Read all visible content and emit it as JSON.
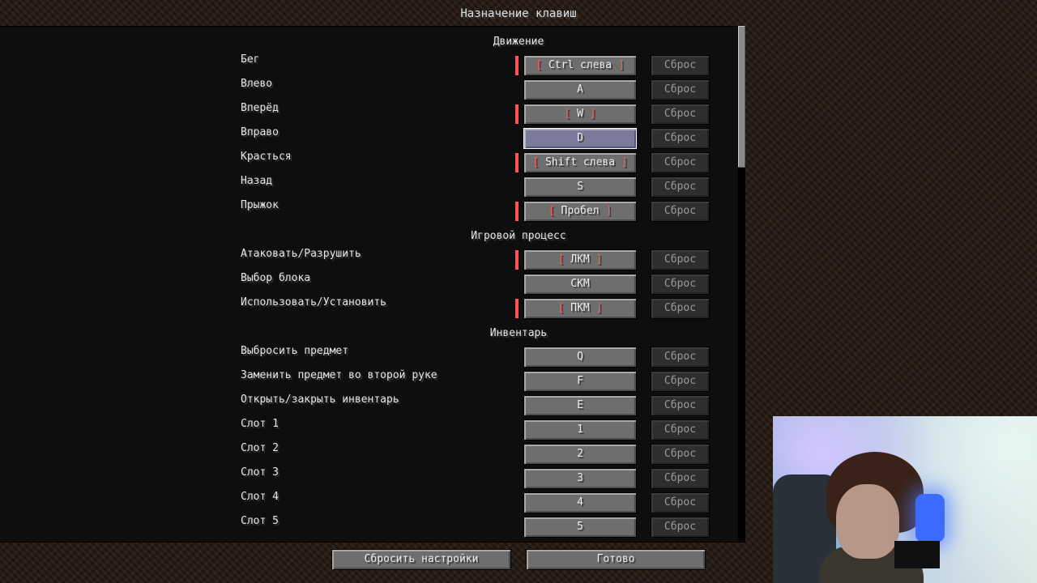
{
  "title": "Назначение клавиш",
  "categories": {
    "movement": "Движение",
    "gameplay": "Игровой процесс",
    "inventory": "Инвентарь"
  },
  "bindings": [
    {
      "action": "Бег",
      "key": "Ctrl слева",
      "conflict": true,
      "reset": "Сброс"
    },
    {
      "action": "Влево",
      "key": "A",
      "conflict": false,
      "reset": "Сброс"
    },
    {
      "action": "Вперёд",
      "key": "W",
      "conflict": true,
      "reset": "Сброс"
    },
    {
      "action": "Вправо",
      "key": "D",
      "conflict": false,
      "reset": "Сброс",
      "hover": true
    },
    {
      "action": "Красться",
      "key": "Shift слева",
      "conflict": true,
      "reset": "Сброс"
    },
    {
      "action": "Назад",
      "key": "S",
      "conflict": false,
      "reset": "Сброс"
    },
    {
      "action": "Прыжок",
      "key": "Пробел",
      "conflict": true,
      "reset": "Сброс"
    },
    {
      "action": "Атаковать/Разрушить",
      "key": "ЛКМ",
      "conflict": true,
      "reset": "Сброс"
    },
    {
      "action": "Выбор блока",
      "key": "СКМ",
      "conflict": false,
      "reset": "Сброс"
    },
    {
      "action": "Использовать/Установить",
      "key": "ПКМ",
      "conflict": true,
      "reset": "Сброс"
    },
    {
      "action": "Выбросить предмет",
      "key": "Q",
      "conflict": false,
      "reset": "Сброс"
    },
    {
      "action": "Заменить предмет во второй руке",
      "key": "F",
      "conflict": false,
      "reset": "Сброс"
    },
    {
      "action": "Открыть/закрыть инвентарь",
      "key": "E",
      "conflict": false,
      "reset": "Сброс"
    },
    {
      "action": "Слот 1",
      "key": "1",
      "conflict": false,
      "reset": "Сброс"
    },
    {
      "action": "Слот 2",
      "key": "2",
      "conflict": false,
      "reset": "Сброс"
    },
    {
      "action": "Слот 3",
      "key": "3",
      "conflict": false,
      "reset": "Сброс"
    },
    {
      "action": "Слот 4",
      "key": "4",
      "conflict": false,
      "reset": "Сброс"
    },
    {
      "action": "Слот 5",
      "key": "5",
      "conflict": false,
      "reset": "Сброс"
    }
  ],
  "footer": {
    "reset_all": "Сбросить настройки",
    "done": "Готово"
  },
  "colors": {
    "conflict": "#ff5555",
    "label": "#e8e8e8"
  }
}
